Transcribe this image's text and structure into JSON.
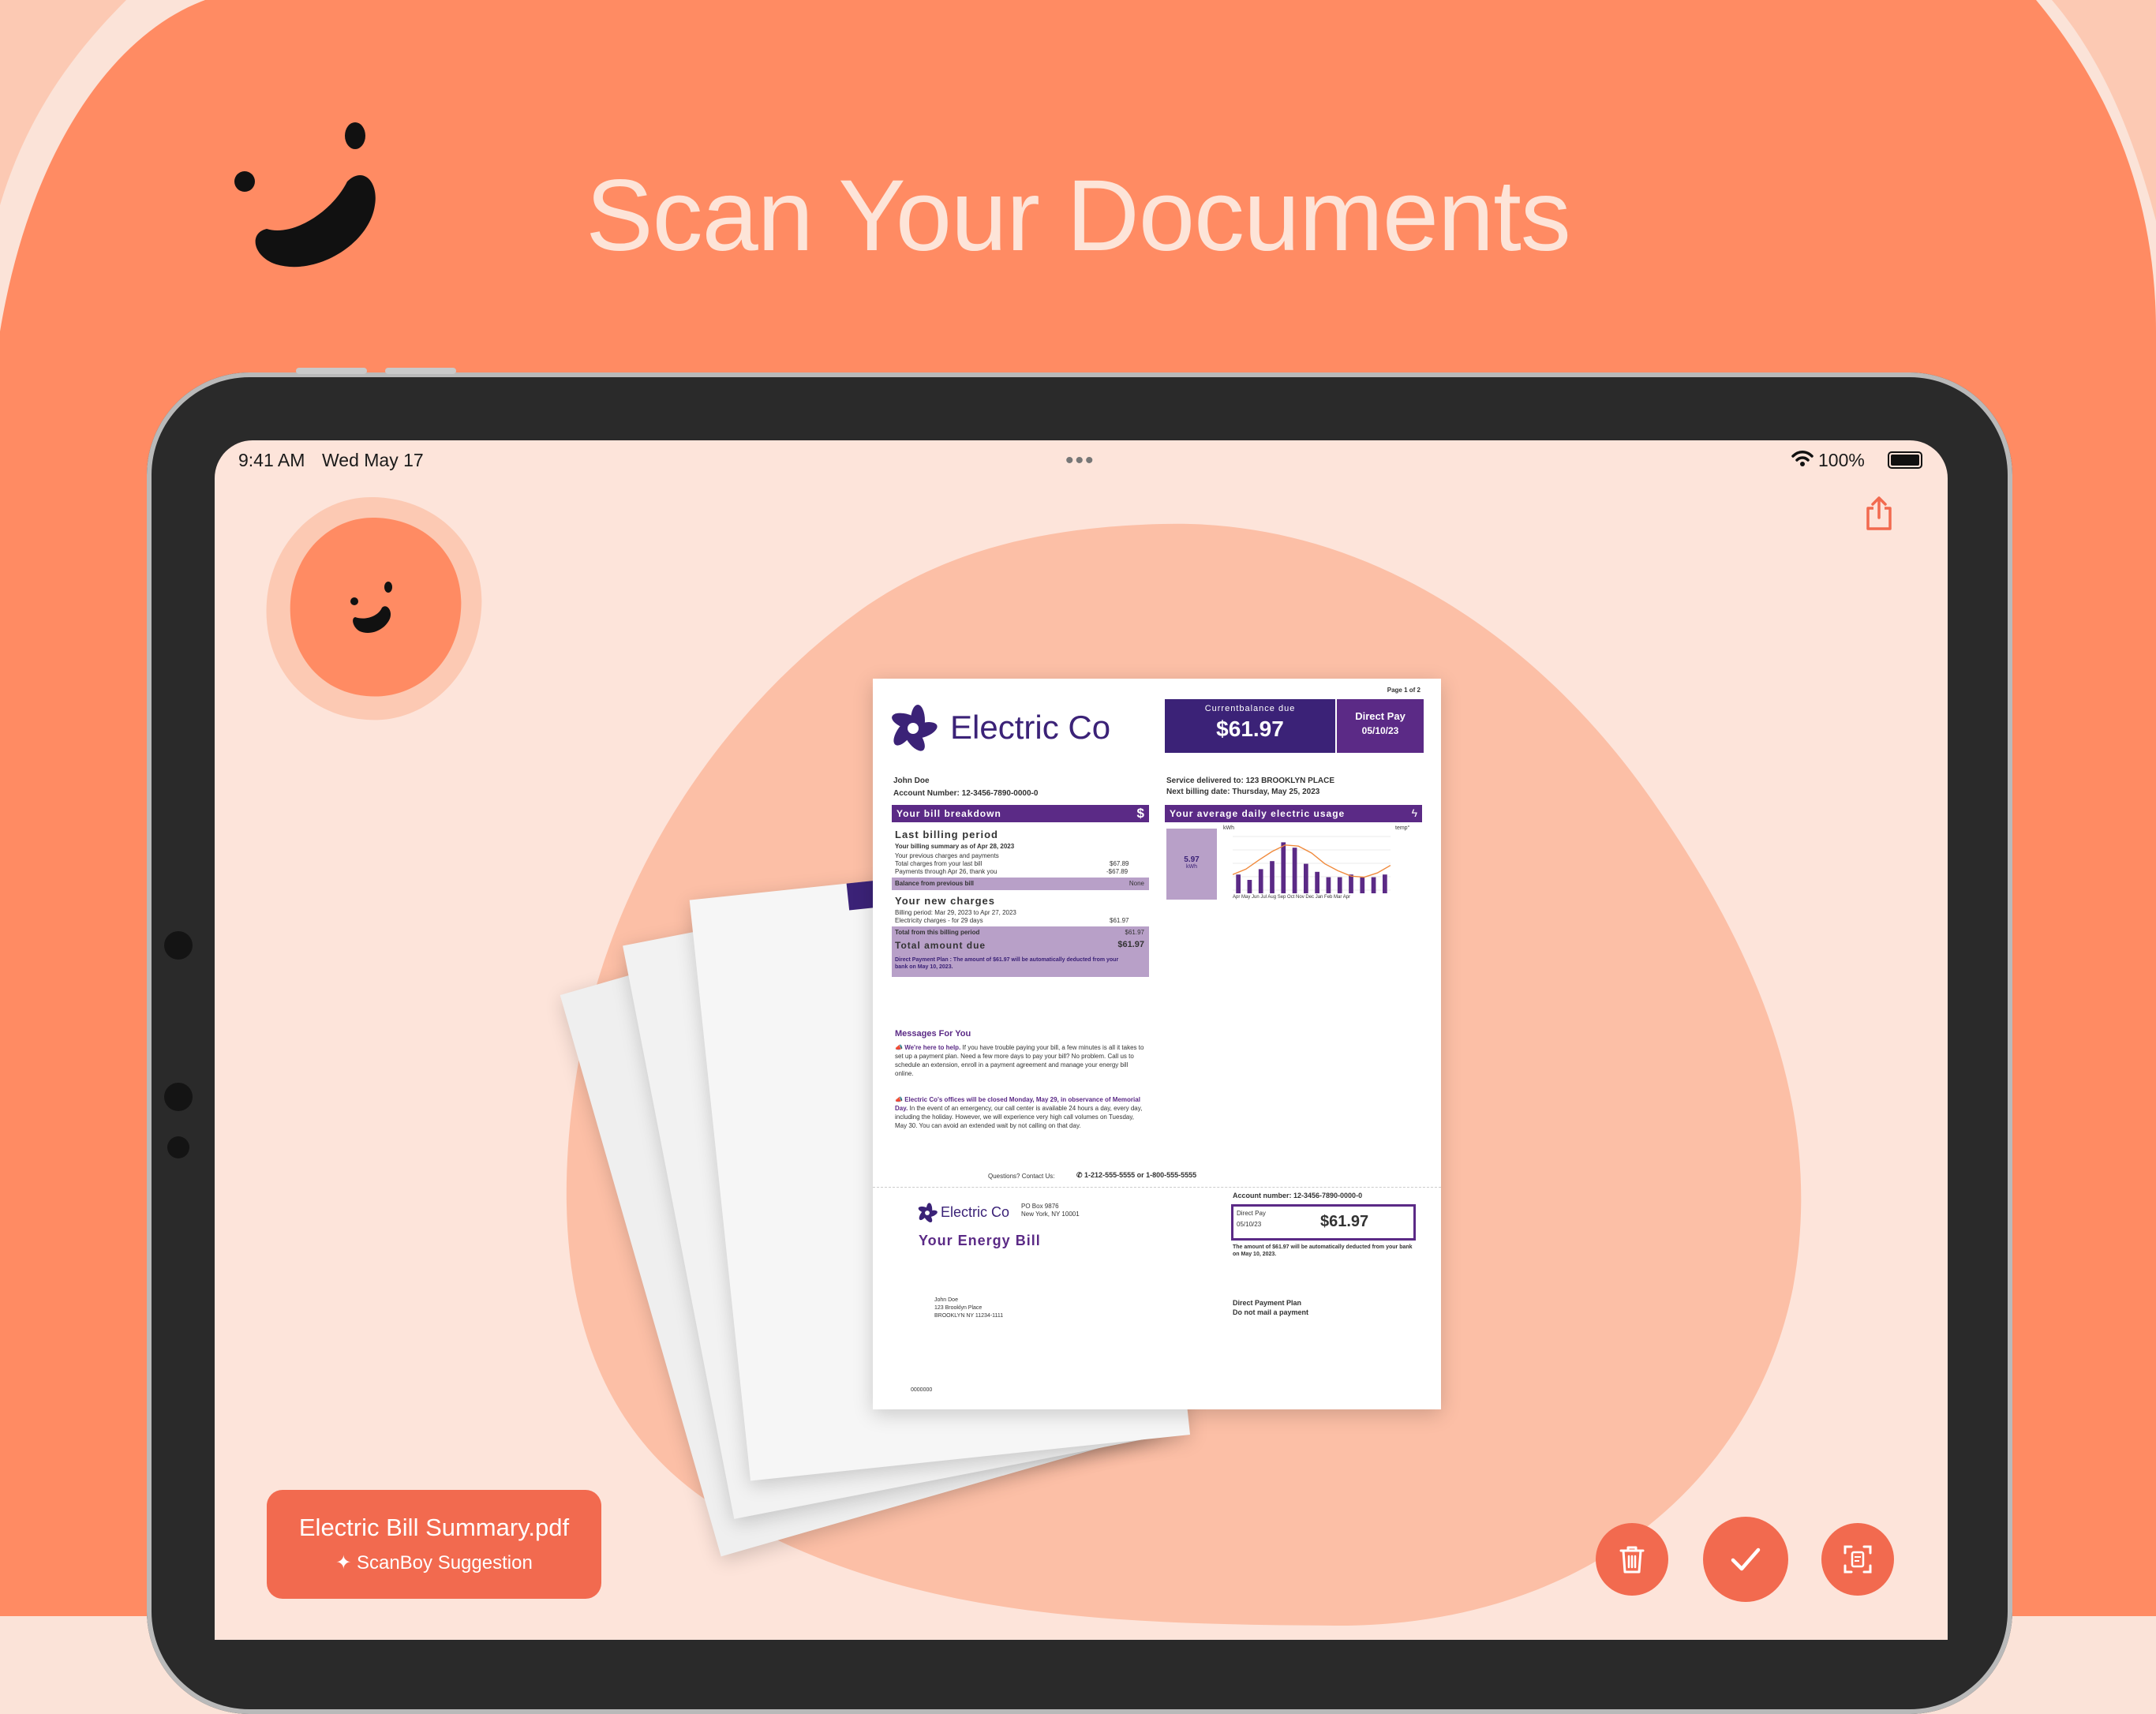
{
  "headline": "Scan Your Documents",
  "status_bar": {
    "time": "9:41 AM",
    "date": "Wed May 17",
    "battery": "100%"
  },
  "colors": {
    "accent": "#f26a4f",
    "background": "#fbe3d8",
    "blob": "#ff8b63",
    "doc_purple": "#5b2a86"
  },
  "toolbar": {
    "share_icon": "share-icon"
  },
  "document": {
    "logo_text": "Electric Co",
    "page_label": "Page 1 of 2",
    "balance_label": "Currentbalance due",
    "balance_amount": "$61.97",
    "direct_pay_label": "Direct Pay",
    "direct_pay_date": "05/10/23",
    "customer_name": "John Doe",
    "account_number_line": "Account Number:  12-3456-7890-0000-0",
    "service_line": "Service delivered  to: 123 BROOKLYN PLACE",
    "next_billing_line": "Next billing date: Thursday, May 25, 2023",
    "breakdown_title": "Your bill breakdown",
    "last_period_title": "Last billing period",
    "summary_line": "Your billing summary as of Apr 28, 2023",
    "prev_charges": "Your previous charges and payments",
    "total_charges_label": "Total charges from your last bill",
    "total_charges_value": "$67.89",
    "payments_label": "Payments through Apr 26, thank you",
    "payments_value": "-$67.89",
    "balance_prev_label": "Balance from previous bill",
    "balance_prev_value": "None",
    "new_charges_title": "Your new charges",
    "billing_period_line": "Billing period: Mar 29, 2023 to Apr 27, 2023",
    "electricity_label": "Electricity charges - for 29 days",
    "electricity_value": "$61.97",
    "total_period_label": "Total from this billing period",
    "total_period_value": "$61.97",
    "total_due_label": "Total amount due",
    "total_due_value": "$61.97",
    "direct_plan_note": "Direct Payment Plan : The amount of $61.97 will be automatically deducted from your bank on May 10, 2023.",
    "usage_title": "Your average daily electric usage",
    "usage_value": "5.97",
    "usage_unit": "kWh",
    "usage_axis_left": "kWh",
    "usage_axis_right": "temp°",
    "usage_months": "Apr May Jun Jul Aug Sep Oct Nov Dec Jan Feb Mar Apr",
    "messages_title": "Messages For You",
    "message1_head": "We're here to help.",
    "message1_body": "If you have trouble paying your bill, a few minutes is all it takes to set up a payment plan. Need a few more days to pay your bill? No problem. Call us to schedule an extension, enroll in a payment agreement and manage your energy bill online.",
    "message2_head": "Electric Co's offices will be closed Monday, May 29, in observance of Memorial Day.",
    "message2_body": "In the event of an emergency, our call center is available 24 hours a day, every day, including the holiday. However, we will experience very high call volumes on Tuesday, May 30. You can avoid an extended wait by not calling on that day.",
    "questions_line": "Questions?  Contact Us:",
    "phone_line": "1-212-555-5555 or 1-800-555-5555",
    "stub_logo": "Electric Co",
    "stub_address1": "PO Box 9876",
    "stub_address2": "New York, NY 10001",
    "stub_title": "Your Energy Bill",
    "stub_account": "Account number:   12-3456-7890-0000-0",
    "stub_direct_pay": "Direct Pay",
    "stub_date": "05/10/23",
    "stub_amount": "$61.97",
    "stub_note": "The amount of $61.97 will be automatically deducted from your bank on May 10, 2023.",
    "stub_customer": "John Doe",
    "stub_street": "123 Brooklyn Place",
    "stub_city": "BROOKLYN NY 11234-1111",
    "stub_plan1": "Direct Payment Plan",
    "stub_plan2": "Do not mail a payment",
    "stub_code": "0000000",
    "chart_bars": [
      0.35,
      0.25,
      0.45,
      0.6,
      0.95,
      0.85,
      0.55,
      0.4,
      0.3,
      0.3,
      0.35,
      0.3,
      0.3,
      0.35
    ],
    "chart_temp": [
      0.35,
      0.45,
      0.62,
      0.78,
      0.9,
      0.88,
      0.75,
      0.55,
      0.42,
      0.32,
      0.3,
      0.38,
      0.52
    ]
  },
  "suggestion": {
    "filename": "Electric Bill Summary.pdf",
    "subtitle": "ScanBoy Suggestion"
  },
  "actions": {
    "delete_icon": "trash-icon",
    "confirm_icon": "checkmark-icon",
    "scan_icon": "scan-document-icon"
  }
}
